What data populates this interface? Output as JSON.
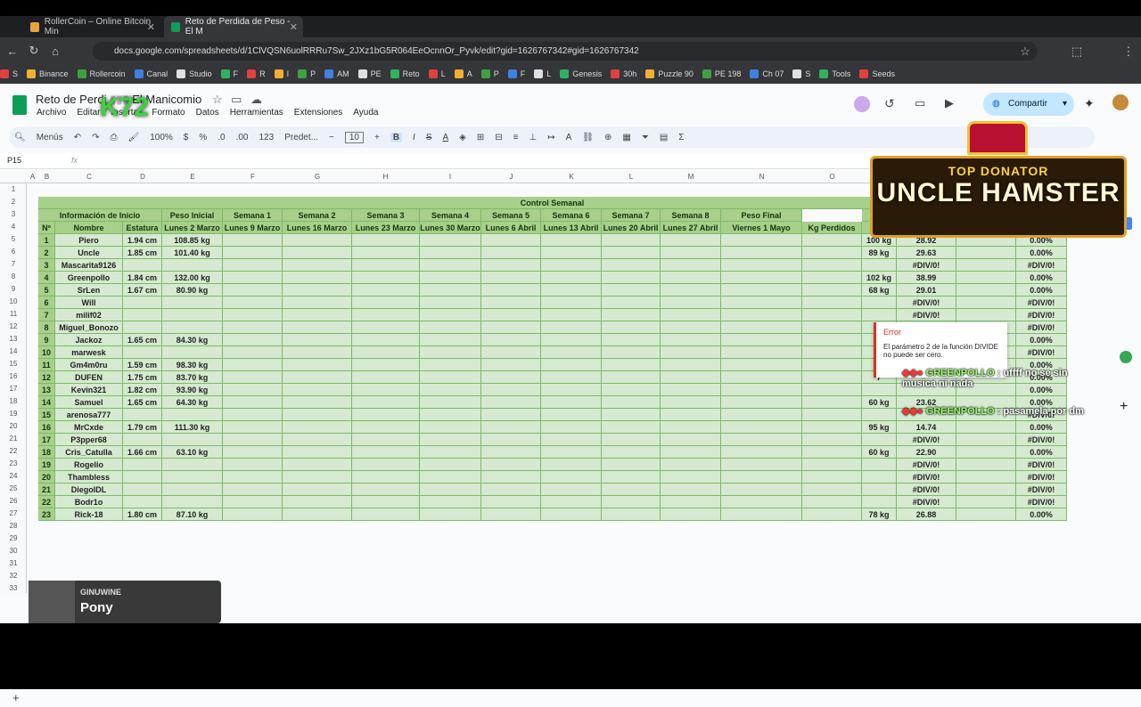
{
  "browser": {
    "tabs": [
      {
        "title": "RollerCoin – Online Bitcoin Min",
        "active": false
      },
      {
        "title": "Reto de Perdida de Peso - El M",
        "active": true
      }
    ],
    "url": "docs.google.com/spreadsheets/d/1ClVQSN6uolRRRu7Sw_2JXz1bG5R064EeOcnnOr_Pyvk/edit?gid=1626767342#gid=1626767342",
    "bookmarks": [
      "S",
      "Binance",
      "Rollercoin",
      "Canal",
      "Studio",
      "F",
      "R",
      "I",
      "P",
      "AM",
      "PE",
      "Reto",
      "L",
      "A",
      "P",
      "F",
      "L",
      "Genesis",
      "30h",
      "Puzzle 90",
      "PE 198",
      "Ch 07",
      "S",
      "Tools",
      "Seeds"
    ]
  },
  "sheet": {
    "title": "Reto de Perdida de Peso - El Manicomio",
    "title_visible": "Reto de Perdi",
    "title_tail": "El Manicomio",
    "menu": [
      "Archivo",
      "Editar",
      "Insertar",
      "Formato",
      "Datos",
      "Herramientas",
      "Extensiones",
      "Ayuda"
    ],
    "share_label": "Compartir",
    "toolbar": {
      "menus": "Menús",
      "zoom": "100%",
      "currency": "$",
      "percent": "%",
      "dec_less": ".0",
      "dec_more": ".00",
      "numfmt": "123",
      "font": "Predet...",
      "font_size": "10"
    },
    "cell_ref": "P15",
    "fx": "fx"
  },
  "columns": [
    "A",
    "B",
    "C",
    "D",
    "E",
    "F",
    "G",
    "H",
    "I",
    "J",
    "K",
    "L",
    "M",
    "N",
    "O"
  ],
  "row_numbers": [
    "1",
    "2",
    "3",
    "4",
    "5",
    "6",
    "7",
    "8",
    "9",
    "10",
    "11",
    "12",
    "13",
    "14",
    "15",
    "16",
    "17",
    "18",
    "19",
    "20",
    "21",
    "22",
    "23",
    "24",
    "25",
    "26",
    "27",
    "28",
    "29",
    "30",
    "31",
    "32",
    "33"
  ],
  "table": {
    "banner": "Control Semanal",
    "header_row1": [
      "Información de Inicio",
      "Peso Inicial",
      "Semana 1",
      "Semana 2",
      "Semana 3",
      "Semana 4",
      "Semana 5",
      "Semana 6",
      "Semana 7",
      "Semana 8",
      "Peso Final"
    ],
    "header_row2": [
      "Nº",
      "Nombre",
      "Estatura",
      "Lunes 2 Marzo",
      "Lunes 9 Marzo",
      "Lunes 16 Marzo",
      "Lunes 23 Marzo",
      "Lunes 30 Marzo",
      "Lunes 6 Abril",
      "Lunes 13 Abril",
      "Lunes 20 Abril",
      "Lunes 27 Abril",
      "Viernes 1 Mayo",
      "Kg Perdidos"
    ],
    "rows": [
      {
        "n": "1",
        "name": "Piero",
        "height": "1.94 cm",
        "weight": "108.85 kg",
        "final": "100 kg",
        "imc": "28.92",
        "pct": "0.00%"
      },
      {
        "n": "2",
        "name": "Uncle",
        "height": "1.85 cm",
        "weight": "101.40 kg",
        "final": "89 kg",
        "imc": "29.63",
        "pct": "0.00%"
      },
      {
        "n": "3",
        "name": "Mascarita9126",
        "height": "",
        "weight": "",
        "final": "",
        "imc": "#DIV/0!",
        "pct": "#DIV/0!"
      },
      {
        "n": "4",
        "name": "Greenpollo",
        "height": "1.84 cm",
        "weight": "132.00 kg",
        "final": "102 kg",
        "imc": "38.99",
        "pct": "0.00%"
      },
      {
        "n": "5",
        "name": "SrLen",
        "height": "1.67 cm",
        "weight": "80.90 kg",
        "final": "68 kg",
        "imc": "29.01",
        "pct": "0.00%"
      },
      {
        "n": "6",
        "name": "Will",
        "height": "",
        "weight": "",
        "final": "",
        "imc": "#DIV/0!",
        "pct": "#DIV/0!"
      },
      {
        "n": "7",
        "name": "milif02",
        "height": "",
        "weight": "",
        "final": "",
        "imc": "#DIV/0!",
        "pct": "#DIV/0!"
      },
      {
        "n": "8",
        "name": "Miguel_Bonozo",
        "height": "",
        "weight": "",
        "final": "",
        "imc": "",
        "pct": "#DIV/0!"
      },
      {
        "n": "9",
        "name": "Jackoz",
        "height": "1.65 cm",
        "weight": "84.30 kg",
        "final": "7",
        "imc": "",
        "pct": "0.00%"
      },
      {
        "n": "10",
        "name": "marwesk",
        "height": "",
        "weight": "",
        "final": "",
        "imc": "",
        "pct": "#DIV/0!"
      },
      {
        "n": "11",
        "name": "Gm4m0ru",
        "height": "1.59 cm",
        "weight": "98.30 kg",
        "final": "",
        "imc": "",
        "pct": "0.00%"
      },
      {
        "n": "12",
        "name": "DUFEN",
        "height": "1.75 cm",
        "weight": "83.70 kg",
        "final": "7",
        "imc": "",
        "pct": "0.00%"
      },
      {
        "n": "13",
        "name": "Kevin321",
        "height": "1.82 cm",
        "weight": "93.90 kg",
        "final": "",
        "imc": "",
        "pct": "0.00%"
      },
      {
        "n": "14",
        "name": "Samuel",
        "height": "1.65 cm",
        "weight": "64.30 kg",
        "final": "60 kg",
        "imc": "23.62",
        "pct": "0.00%"
      },
      {
        "n": "15",
        "name": "arenosa777",
        "height": "",
        "weight": "",
        "final": "",
        "imc": "",
        "pct": "#DIV/0!"
      },
      {
        "n": "16",
        "name": "MrCxde",
        "height": "1.79 cm",
        "weight": "111.30 kg",
        "final": "95 kg",
        "imc": "14.74",
        "pct": "0.00%"
      },
      {
        "n": "17",
        "name": "P3pper68",
        "height": "",
        "weight": "",
        "final": "",
        "imc": "#DIV/0!",
        "pct": "#DIV/0!"
      },
      {
        "n": "18",
        "name": "Cris_Catulla",
        "height": "1.66 cm",
        "weight": "63.10 kg",
        "final": "60 kg",
        "imc": "22.90",
        "pct": "0.00%"
      },
      {
        "n": "19",
        "name": "Rogelio",
        "height": "",
        "weight": "",
        "final": "",
        "imc": "#DIV/0!",
        "pct": "#DIV/0!"
      },
      {
        "n": "20",
        "name": "Thambless",
        "height": "",
        "weight": "",
        "final": "",
        "imc": "#DIV/0!",
        "pct": "#DIV/0!"
      },
      {
        "n": "21",
        "name": "DiegoIDL",
        "height": "",
        "weight": "",
        "final": "",
        "imc": "#DIV/0!",
        "pct": "#DIV/0!"
      },
      {
        "n": "22",
        "name": "Bodr1o",
        "height": "",
        "weight": "",
        "final": "",
        "imc": "#DIV/0!",
        "pct": "#DIV/0!"
      },
      {
        "n": "23",
        "name": "Rick-18",
        "height": "1.80 cm",
        "weight": "87.10 kg",
        "final": "78 kg",
        "imc": "26.88",
        "pct": "0.00%"
      }
    ]
  },
  "error_tooltip": {
    "title": "Error",
    "message": "El parámetro 2 de la función DIVIDE no puede ser cero."
  },
  "chat": [
    {
      "user": "GREENPOLLO",
      "message": ": uffff no se sin musica ni nada"
    },
    {
      "user": "GREENPOLLO",
      "message": ": pasamela por dm"
    }
  ],
  "overlay": {
    "donator_label": "TOP DONATOR",
    "donator_name": "UNCLE HAMSTER",
    "logo": "K72"
  },
  "music": {
    "artist": "GINUWINE",
    "song": "Pony"
  },
  "colors": {
    "header_green": "#a7d08a",
    "body_green": "#d5ead0",
    "share_blue": "#c2e7ff",
    "error_red": "#d93025"
  }
}
